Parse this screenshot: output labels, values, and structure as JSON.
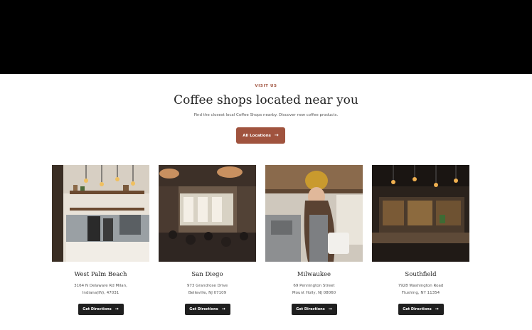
{
  "header": {
    "eyebrow": "VISIT US",
    "title": "Coffee shops located near you",
    "subtitle": "Find the closest local Coffee Shops nearby. Discover new coffee products.",
    "cta_label": "All Locations",
    "cta_icon": "arrow-right-icon"
  },
  "colors": {
    "accent": "#a0533e",
    "eyebrow": "#a0533e",
    "top_band": "#000000",
    "button_dark": "#1f1f1f"
  },
  "locations": [
    {
      "city": "West Palm Beach",
      "address_line1": "3164 N Delaware Rd Milan,",
      "address_line2": "Indiana(IN), 47031",
      "button_label": "Get Directions"
    },
    {
      "city": "San Diego",
      "address_line1": "973 Grandrose Drive",
      "address_line2": "Belleville, NJ 07109",
      "button_label": "Get Directions"
    },
    {
      "city": "Milwaukee",
      "address_line1": "69 Pennington Street",
      "address_line2": "Mount Holly, NJ 08060",
      "button_label": "Get Directions"
    },
    {
      "city": "Southfield",
      "address_line1": "7928 Washington Road",
      "address_line2": "Flushing, NY 11354",
      "button_label": "Get Directions"
    }
  ]
}
